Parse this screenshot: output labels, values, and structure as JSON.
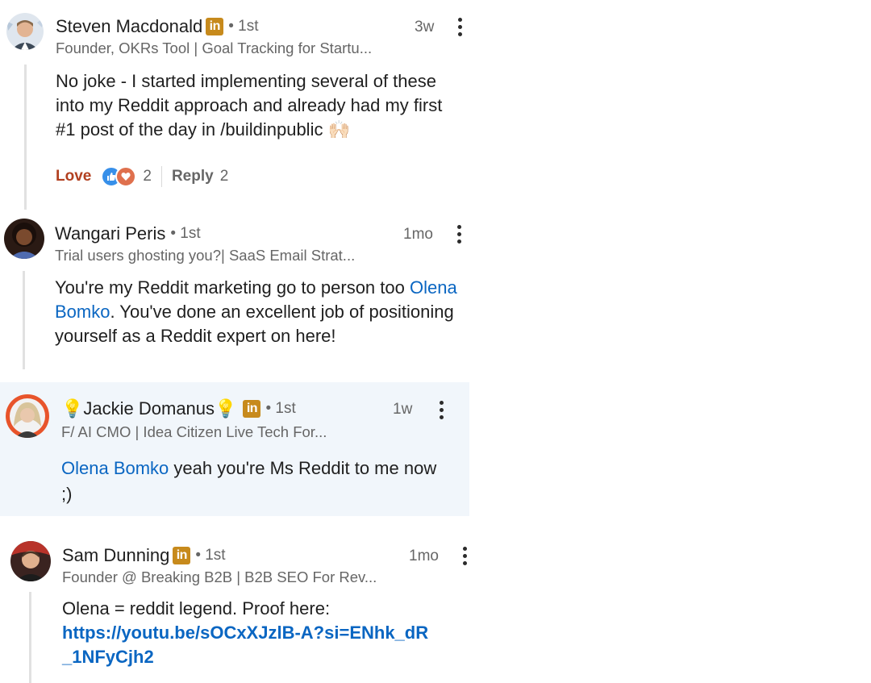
{
  "comments": [
    {
      "name": "Steven Macdonald",
      "degree": "• 1st",
      "time": "3w",
      "headline": "Founder, OKRs Tool | Goal Tracking for Startu...",
      "body": "No joke - I started implementing several of these into my Reddit approach and already had my first #1 post of the day in /buildinpublic 🙌🏻",
      "love_label": "Love",
      "reaction_count": "2",
      "reply_label": "Reply",
      "reply_count": "2"
    },
    {
      "name": "Wangari Peris",
      "degree": "• 1st",
      "time": "1mo",
      "headline": "Trial users ghosting you?| SaaS Email Strat...",
      "body_before": "You're my Reddit marketing go to person too ",
      "mention": "Olena Bomko",
      "body_after": ". You've done an excellent job of positioning yourself as a Reddit expert on here!"
    },
    {
      "name": "Jackie Domanus",
      "bulb": "💡",
      "degree": "• 1st",
      "time": "1w",
      "headline": "F/ AI CMO | Idea Citizen Live Tech For...",
      "mention": "Olena Bomko",
      "body_after": " yeah you're Ms Reddit to me now ;)"
    },
    {
      "name": "Sam Dunning",
      "degree": "• 1st",
      "time": "1mo",
      "headline": "Founder @ Breaking B2B | B2B SEO For Rev...",
      "body": "Olena = reddit legend. Proof here:",
      "link_line1": "https://youtu.be/sOCxXJzlB-A?si=ENhk_dR",
      "link_line2": "_1NFyCjh2"
    }
  ],
  "linkedin_badge": "in",
  "colors": {
    "link": "#0a66c2",
    "love": "#b24020",
    "badge": "#c78a1c",
    "highlight": "#f1f6fb"
  }
}
